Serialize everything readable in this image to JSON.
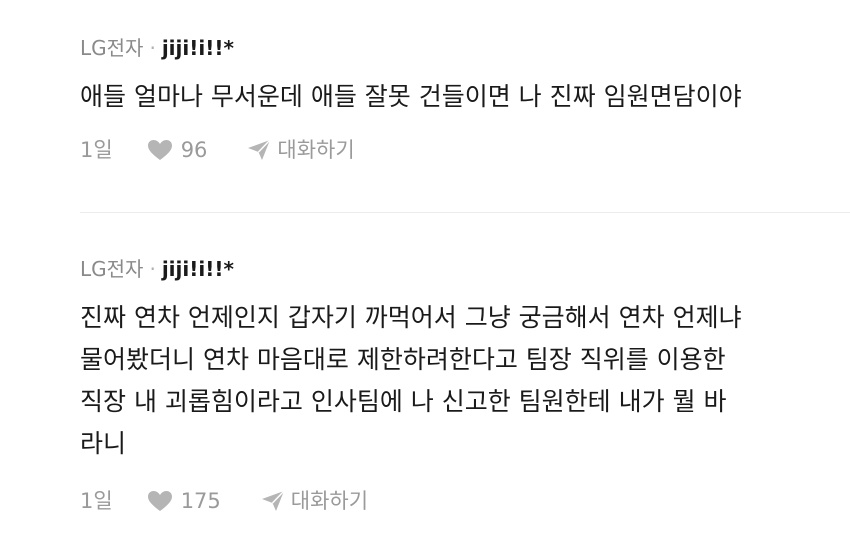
{
  "comments": [
    {
      "company": "LG전자",
      "separator": "·",
      "nickname": "jiji!i!!*",
      "text": "애들 얼마나 무서운데 애들 잘못 건들이면 나 진짜 임원면담이야",
      "time": "1일",
      "likes": "96",
      "reply_label": "대화하기"
    },
    {
      "company": "LG전자",
      "separator": "·",
      "nickname": "jiji!i!!*",
      "text": "진짜 연차 언제인지 갑자기 까먹어서 그냥 궁금해서 연차 언제냐\n물어봤더니 연차 마음대로 제한하려한다고 팀장 직위를 이용한\n직장 내 괴롭힘이라고 인사팀에 나 신고한 팀원한테 내가 뭘 바\n라니",
      "time": "1일",
      "likes": "175",
      "reply_label": "대화하기"
    }
  ],
  "colors": {
    "meta": "#8a8a8a",
    "icon": "#b5b5b5",
    "divider": "#ececec"
  }
}
